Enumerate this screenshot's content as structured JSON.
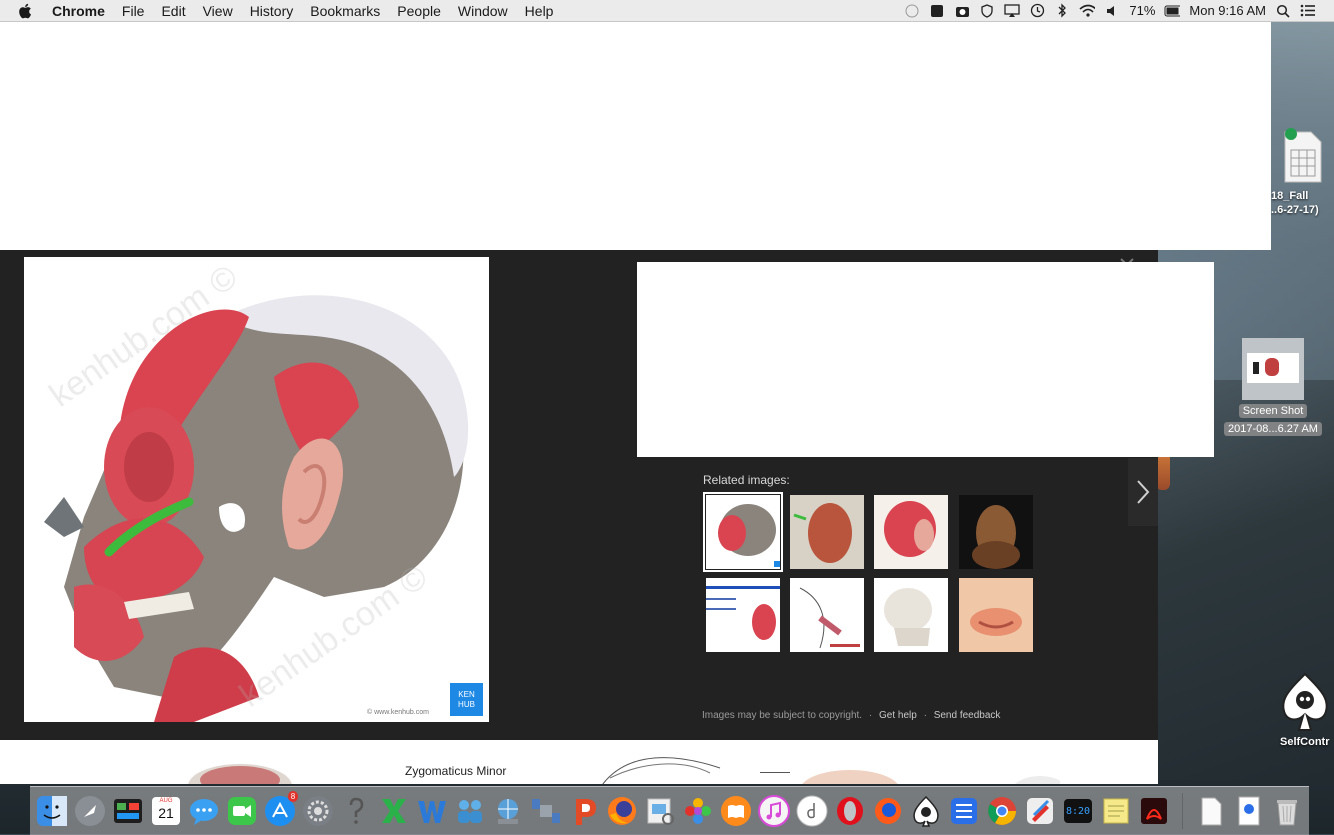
{
  "menubar": {
    "app_name": "Chrome",
    "items": [
      "File",
      "Edit",
      "View",
      "History",
      "Bookmarks",
      "People",
      "Window",
      "Help"
    ],
    "battery": "71%",
    "clock": "Mon 9:16 AM"
  },
  "viewer": {
    "related_title": "Related images:",
    "watermark": "kenhub.com ©",
    "badge_top": "KEN",
    "badge_bottom": "HUB",
    "credit": "© www.kenhub.com",
    "footer": {
      "notice": "Images may be subject to copyright.",
      "help": "Get help",
      "feedback": "Send feedback",
      "separator": "·"
    }
  },
  "results_strip": {
    "caption": "Zygomaticus Minor"
  },
  "desktop": {
    "file1_label_line1": "18_Fall",
    "file1_label_line2": "..6-27-17)",
    "screenshot_label_line1": "Screen Shot",
    "screenshot_label_line2": "2017-08...6.27 AM",
    "selfcontrol_label": "SelfContr"
  },
  "dock": {
    "calendar_month": "AUG",
    "calendar_day": "21",
    "appstore_badge": "8",
    "clock_display": "8:20"
  }
}
